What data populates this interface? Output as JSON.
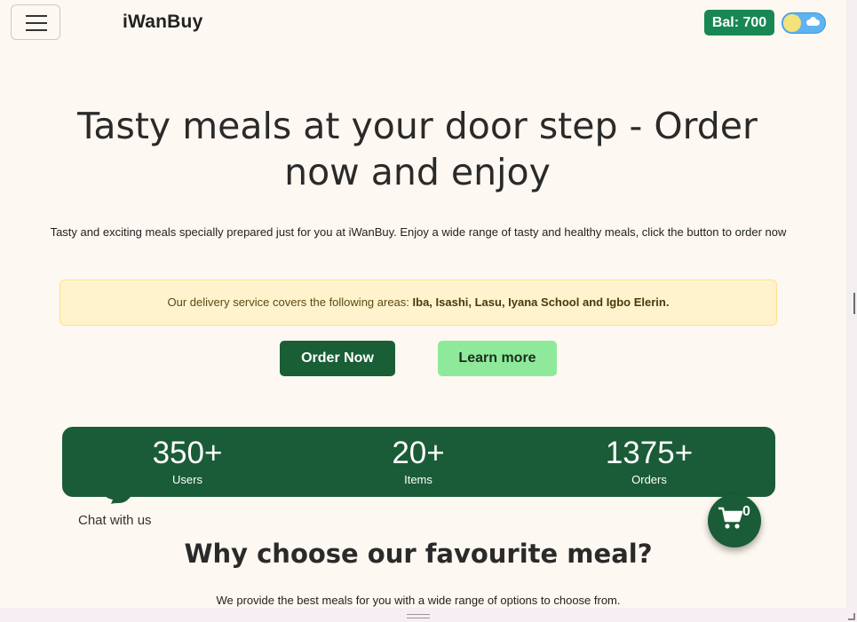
{
  "navbar": {
    "brand": "iWanBuy",
    "balance": "Bal: 700"
  },
  "hero": {
    "title": "Tasty meals at your door step - Order now and enjoy",
    "subtitle": "Tasty and exciting meals specially prepared just for you at iWanBuy. Enjoy a wide range of tasty and healthy meals, click the button to order now"
  },
  "delivery_alert": {
    "prefix": "Our delivery service covers the following areas:",
    "areas": "Iba, Isashi, Lasu, Iyana School and Igbo Elerin."
  },
  "buttons": {
    "order_now": "Order Now",
    "learn_more": "Learn more"
  },
  "stats": [
    {
      "value": "350+",
      "label": "Users"
    },
    {
      "value": "20+",
      "label": "Items"
    },
    {
      "value": "1375+",
      "label": "Orders"
    }
  ],
  "chat": {
    "label": "Chat with us"
  },
  "cart": {
    "count": "0",
    "icon": "cart-icon"
  },
  "why_section": {
    "title": "Why choose our favourite meal?",
    "subtitle": "We provide the best meals for you with a wide range of options to choose from."
  },
  "colors": {
    "primary_green": "#1a5c37",
    "balance_green": "#198754",
    "learn_green": "#8eea9a",
    "alert_bg": "#fff3cd",
    "page_bg": "#fdf8f1"
  }
}
